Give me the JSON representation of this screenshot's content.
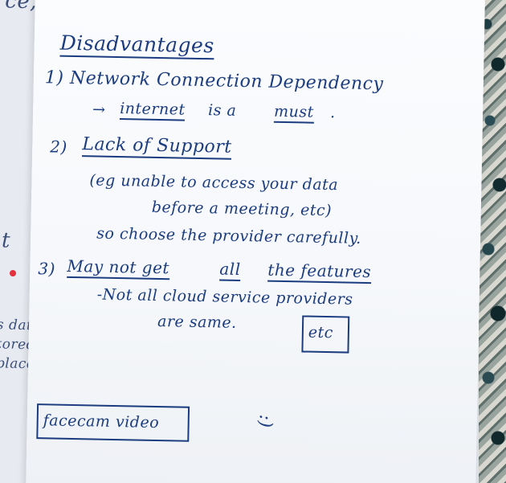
{
  "left_page": {
    "top_text": "ce,",
    "mid_letter": "t",
    "side_note": [
      "s data",
      "tored at",
      "places."
    ]
  },
  "notes": {
    "heading": "Disadvantages",
    "point1": {
      "title": "1) Network Connection Dependency",
      "sub_arrow": "→",
      "sub_a": "internet",
      "sub_b": "is a",
      "sub_c": "must",
      "sub_d": "."
    },
    "point2": {
      "number": "2)",
      "title": "Lack of Support",
      "line1": "(eg unable to access your data",
      "line2": "before a meeting, etc)",
      "line3": "so choose the provider carefully."
    },
    "point3": {
      "number": "3)",
      "part_a": "May not get",
      "part_b": "all",
      "part_c": "the features",
      "line1": "-Not all cloud service providers",
      "line2": "are same.",
      "boxed": "etc"
    },
    "facecam_box": "facecam video",
    "smiley": ":)"
  },
  "colors": {
    "ink": "#1b3c7f",
    "paper": "#f8f9fc",
    "red_dot": "#e3303d"
  }
}
